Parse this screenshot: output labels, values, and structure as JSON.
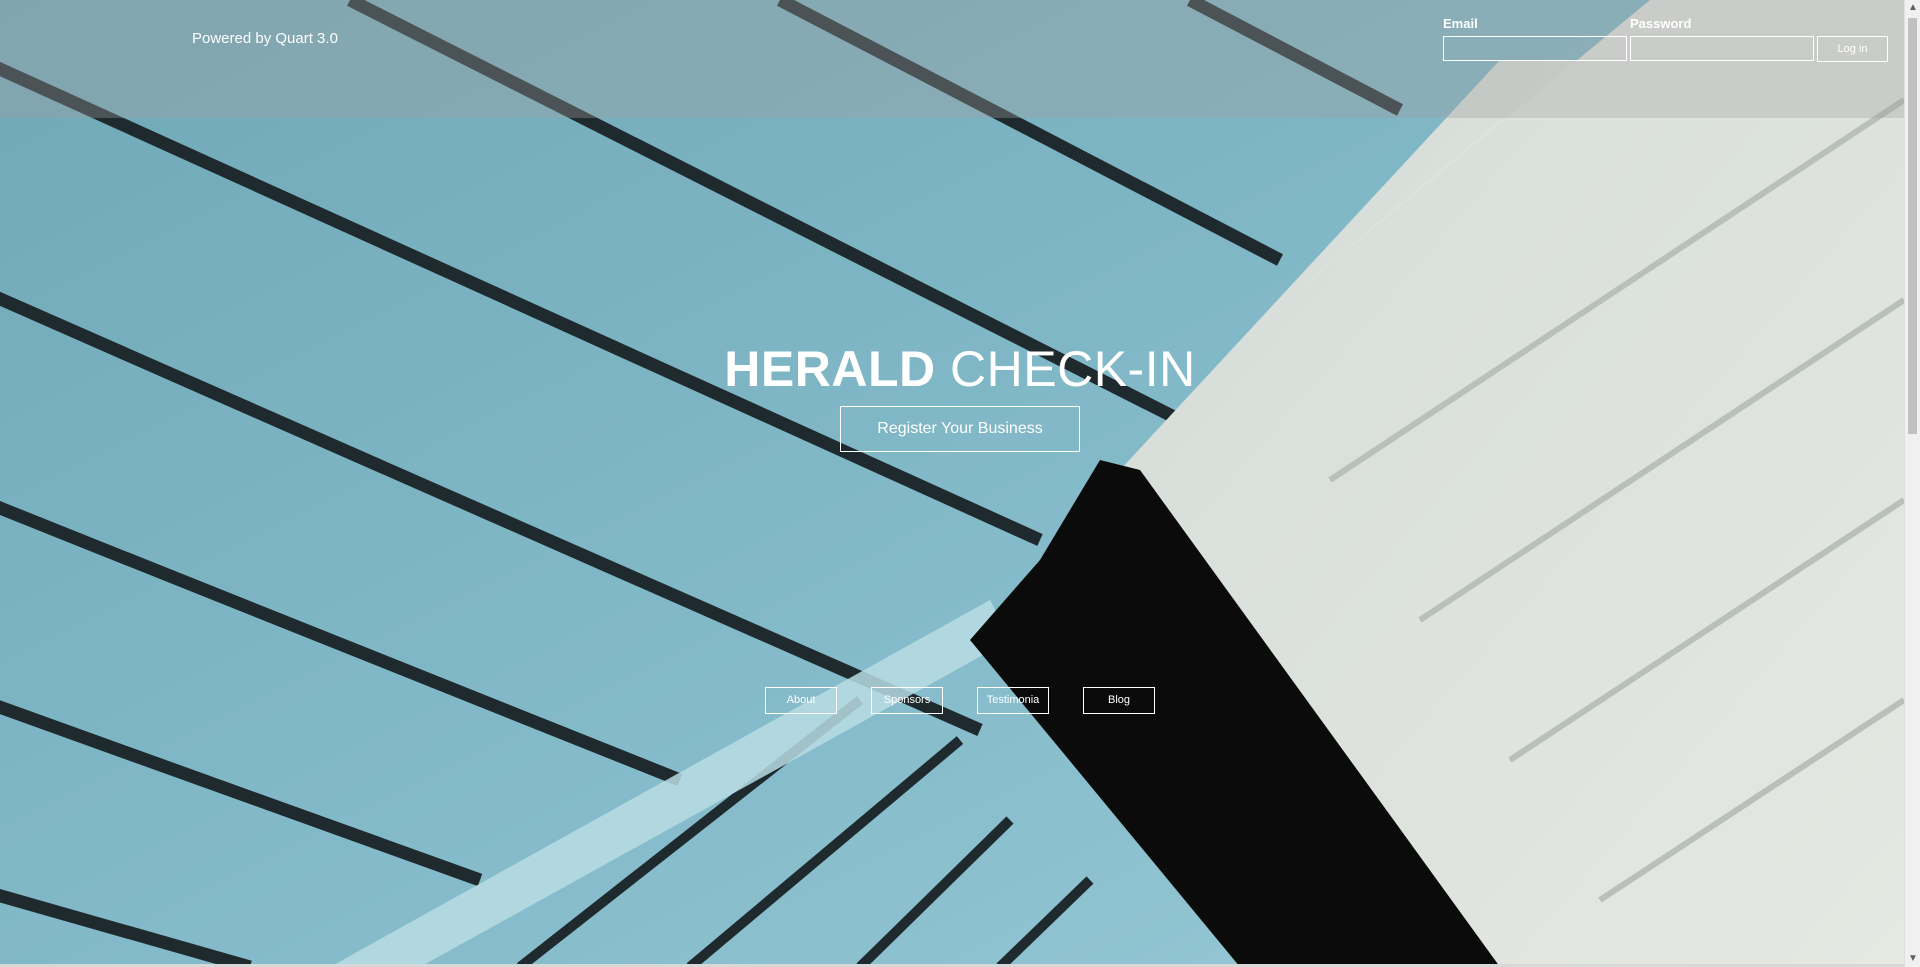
{
  "header": {
    "powered_by": "Powered by Quart 3.0"
  },
  "login": {
    "email_label": "Email",
    "password_label": "Password",
    "email_value": "",
    "password_value": "",
    "login_button": "Log in"
  },
  "hero": {
    "title_bold": "HERALD",
    "title_light": "CHECK-IN",
    "register_button": "Register Your Business"
  },
  "nav": {
    "items": [
      {
        "label": "About"
      },
      {
        "label": "Sponsors"
      },
      {
        "label": "Testimonia"
      },
      {
        "label": "Blog"
      }
    ]
  },
  "scrollbar": {
    "up_icon": "chevron-up-icon",
    "down_icon": "chevron-down-icon"
  }
}
